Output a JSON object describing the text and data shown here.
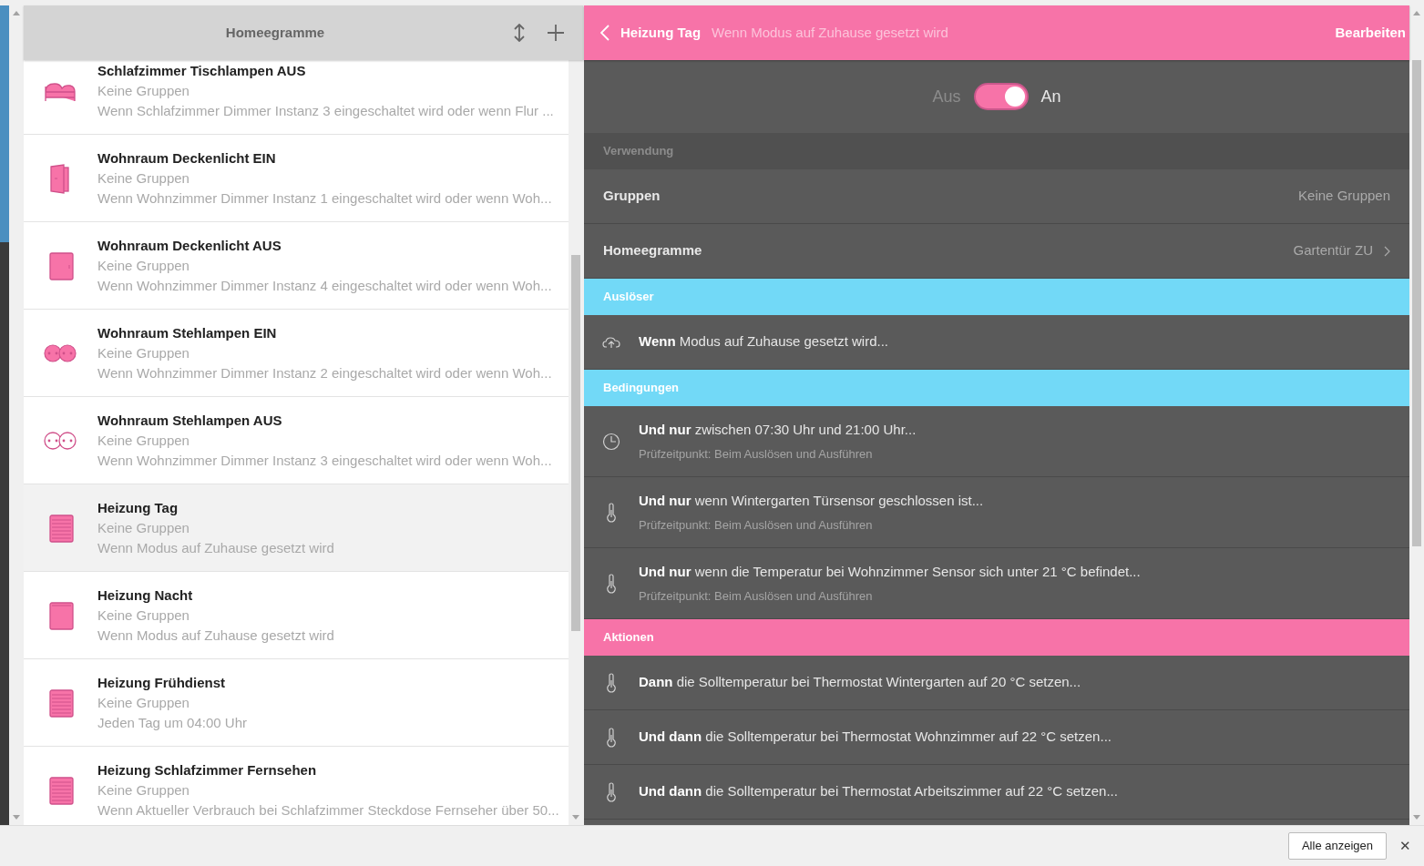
{
  "list_header": {
    "title": "Homeegramme"
  },
  "items": [
    {
      "kind": "bed",
      "title": "Schlafzimmer Tischlampen AUS",
      "groups": "Keine Gruppen",
      "description": "Wenn Schlafzimmer Dimmer Instanz 3 eingeschaltet wird oder wenn Flur ...",
      "selected": false
    },
    {
      "kind": "door-open",
      "title": "Wohnraum Deckenlicht EIN",
      "groups": "Keine Gruppen",
      "description": "Wenn Wohnzimmer Dimmer Instanz 1 eingeschaltet wird oder wenn Woh...",
      "selected": false
    },
    {
      "kind": "door",
      "title": "Wohnraum Deckenlicht AUS",
      "groups": "Keine Gruppen",
      "description": "Wenn Wohnzimmer Dimmer Instanz 4 eingeschaltet wird oder wenn Woh...",
      "selected": false
    },
    {
      "kind": "socket-filled",
      "title": "Wohnraum Stehlampen EIN",
      "groups": "Keine Gruppen",
      "description": "Wenn Wohnzimmer Dimmer Instanz 2 eingeschaltet wird oder wenn Woh...",
      "selected": false
    },
    {
      "kind": "socket-outline",
      "title": "Wohnraum Stehlampen AUS",
      "groups": "Keine Gruppen",
      "description": "Wenn Wohnzimmer Dimmer Instanz 3 eingeschaltet wird oder wenn Woh...",
      "selected": false
    },
    {
      "kind": "radiator",
      "title": "Heizung Tag",
      "groups": "Keine Gruppen",
      "description": "Wenn Modus auf Zuhause gesetzt wird",
      "selected": true
    },
    {
      "kind": "panel",
      "title": "Heizung Nacht",
      "groups": "Keine Gruppen",
      "description": "Wenn Modus auf Zuhause gesetzt wird",
      "selected": false
    },
    {
      "kind": "radiator",
      "title": "Heizung Frühdienst",
      "groups": "Keine Gruppen",
      "description": "Jeden Tag um 04:00 Uhr",
      "selected": false
    },
    {
      "kind": "radiator",
      "title": "Heizung Schlafzimmer Fernsehen",
      "groups": "Keine Gruppen",
      "description": "Wenn Aktueller Verbrauch bei Schlafzimmer Steckdose Fernseher über 50...",
      "selected": false
    }
  ],
  "detail": {
    "title": "Heizung Tag",
    "subtitle": "Wenn Modus auf Zuhause gesetzt wird",
    "edit": "Bearbeiten",
    "toggle": {
      "off_label": "Aus",
      "on_label": "An",
      "on": true
    },
    "usage": {
      "heading": "Verwendung",
      "rows": [
        {
          "label": "Gruppen",
          "value": "Keine Gruppen",
          "link": false
        },
        {
          "label": "Homeegramme",
          "value": "Gartentür ZU",
          "link": true
        }
      ]
    },
    "sections": [
      {
        "heading": "Auslöser",
        "color": "#72d9f7",
        "rows": [
          {
            "kind": "cloud",
            "text": "**Wenn** Modus auf Zuhause gesetzt wird..."
          }
        ]
      },
      {
        "heading": "Bedingungen",
        "color": "#72d9f7",
        "rows": [
          {
            "kind": "clock",
            "text": "**Und nur** zwischen 07:30 Uhr und 21:00 Uhr...",
            "note": "Prüfzeitpunkt: Beim Auslösen und Ausführen"
          },
          {
            "kind": "thermometer",
            "text": "**Und nur** wenn Wintergarten Türsensor geschlossen ist...",
            "note": "Prüfzeitpunkt: Beim Auslösen und Ausführen"
          },
          {
            "kind": "thermometer",
            "text": "**Und nur** wenn die Temperatur bei Wohnzimmer Sensor sich unter 21 °C befindet...",
            "note": "Prüfzeitpunkt: Beim Auslösen und Ausführen"
          }
        ]
      },
      {
        "heading": "Aktionen",
        "color": "#f773a8",
        "rows": [
          {
            "kind": "thermometer",
            "text": "**Dann** die Solltemperatur bei Thermostat Wintergarten auf 20 °C setzen..."
          },
          {
            "kind": "thermometer",
            "text": "**Und dann** die Solltemperatur bei Thermostat Wohnzimmer auf 22 °C setzen..."
          },
          {
            "kind": "thermometer",
            "text": "**Und dann** die Solltemperatur bei Thermostat Arbeitszimmer auf 22 °C setzen..."
          }
        ]
      }
    ]
  },
  "download_bar": {
    "button": "Alle anzeigen",
    "close": "✕"
  }
}
